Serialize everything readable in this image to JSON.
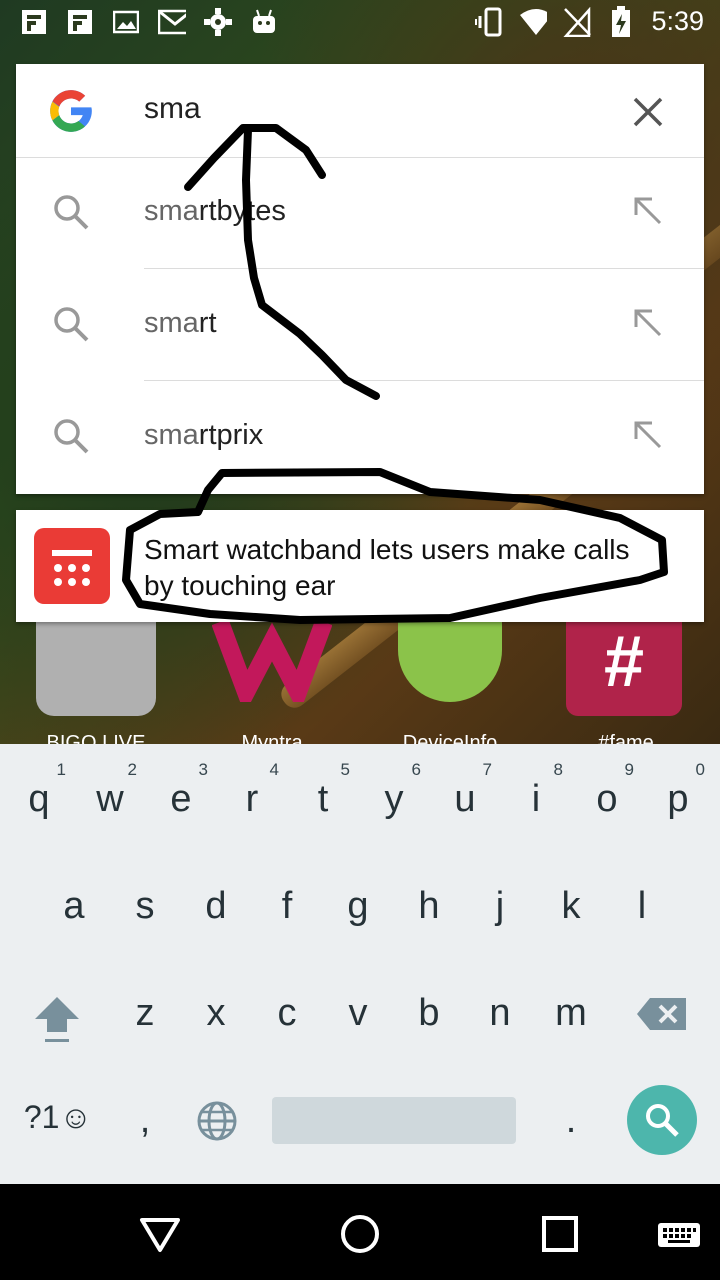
{
  "status_bar": {
    "time": "5:39",
    "left_icons": [
      "flipboard-icon",
      "flipboard-icon",
      "image-icon",
      "gmail-icon",
      "settings-cog-icon",
      "android-icon"
    ],
    "right_icons": [
      "vibrate-icon",
      "wifi-icon",
      "no-sim-icon",
      "battery-charging-icon"
    ]
  },
  "search": {
    "query": "sma",
    "suggestions": [
      {
        "typed": "sma",
        "rest": "rtbytes"
      },
      {
        "typed": "sma",
        "rest": "rt"
      },
      {
        "typed": "sma",
        "rest": "rtprix"
      }
    ]
  },
  "news": {
    "headline": "Smart watchband lets users make calls by touching ear",
    "icon_color": "#ea3b36"
  },
  "apps": [
    {
      "label": "BIGO LIVE"
    },
    {
      "label": "Myntra"
    },
    {
      "label": "DeviceInfo"
    },
    {
      "label": "#fame"
    }
  ],
  "keyboard": {
    "row1": [
      {
        "ch": "q",
        "num": "1"
      },
      {
        "ch": "w",
        "num": "2"
      },
      {
        "ch": "e",
        "num": "3"
      },
      {
        "ch": "r",
        "num": "4"
      },
      {
        "ch": "t",
        "num": "5"
      },
      {
        "ch": "y",
        "num": "6"
      },
      {
        "ch": "u",
        "num": "7"
      },
      {
        "ch": "i",
        "num": "8"
      },
      {
        "ch": "o",
        "num": "9"
      },
      {
        "ch": "p",
        "num": "0"
      }
    ],
    "row2": [
      "a",
      "s",
      "d",
      "f",
      "g",
      "h",
      "j",
      "k",
      "l"
    ],
    "row3": [
      "z",
      "x",
      "c",
      "v",
      "b",
      "n",
      "m"
    ],
    "symbols_key": "?1☺",
    "comma": ",",
    "period": ".",
    "accent_color": "#4db6ac"
  }
}
